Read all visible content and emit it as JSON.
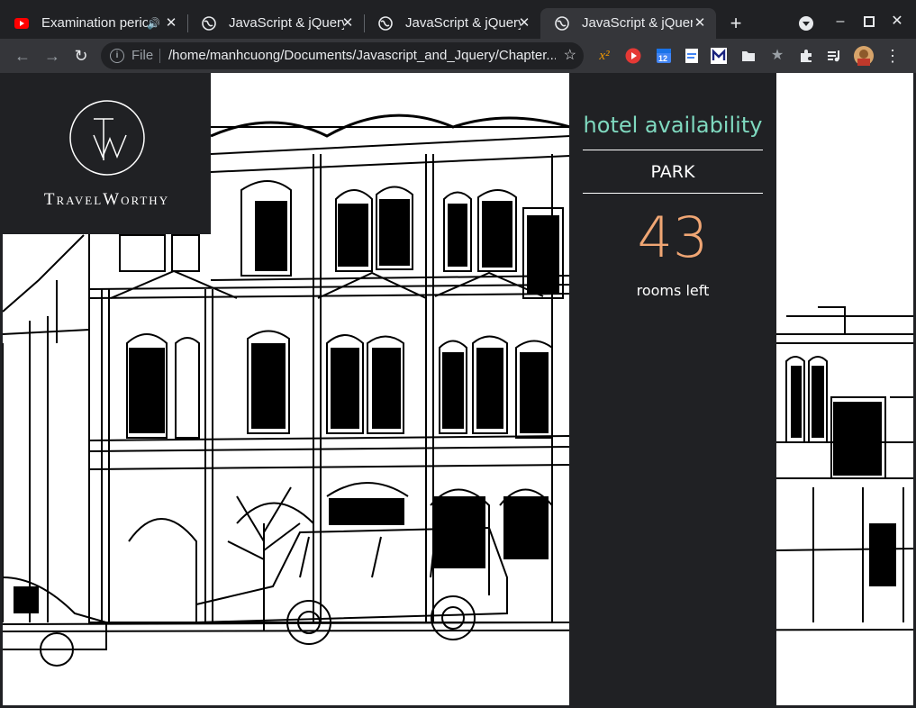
{
  "browser": {
    "tabs": [
      {
        "title": "Examination period",
        "favicon": "youtube-icon",
        "active": false,
        "audible": true
      },
      {
        "title": "JavaScript & jQuery",
        "favicon": "globe-icon",
        "active": false
      },
      {
        "title": "JavaScript & jQuery",
        "favicon": "globe-icon",
        "active": false
      },
      {
        "title": "JavaScript & jQuery",
        "favicon": "globe-icon",
        "active": true
      }
    ],
    "new_tab_label": "+",
    "close_label": "✕",
    "address": {
      "scheme_label": "File",
      "url": "/home/manhcuong/Documents/Javascript_and_Jquery/Chapter..."
    },
    "extensions": [
      "superscript-extension-icon",
      "youtube-extension-icon",
      "calendar-extension-icon",
      "doc-extension-icon",
      "m-extension-icon",
      "folder-extension-icon",
      "star-extension-icon",
      "puzzle-extension-icon",
      "media-queue-icon",
      "profile-avatar"
    ],
    "calendar_badge": "12",
    "colors": {
      "frame": "#202124",
      "toolbar": "#35363a",
      "text": "#e8eaed"
    }
  },
  "page": {
    "logo": {
      "text": "TravelWorthy",
      "mark": "TW"
    },
    "availability": {
      "title": "hotel availability",
      "hotel": "PARK",
      "rooms": "43",
      "rooms_label": "rooms left"
    },
    "colors": {
      "panel": "#202124",
      "title": "#7fd9bf",
      "count": "#f0a674"
    }
  }
}
